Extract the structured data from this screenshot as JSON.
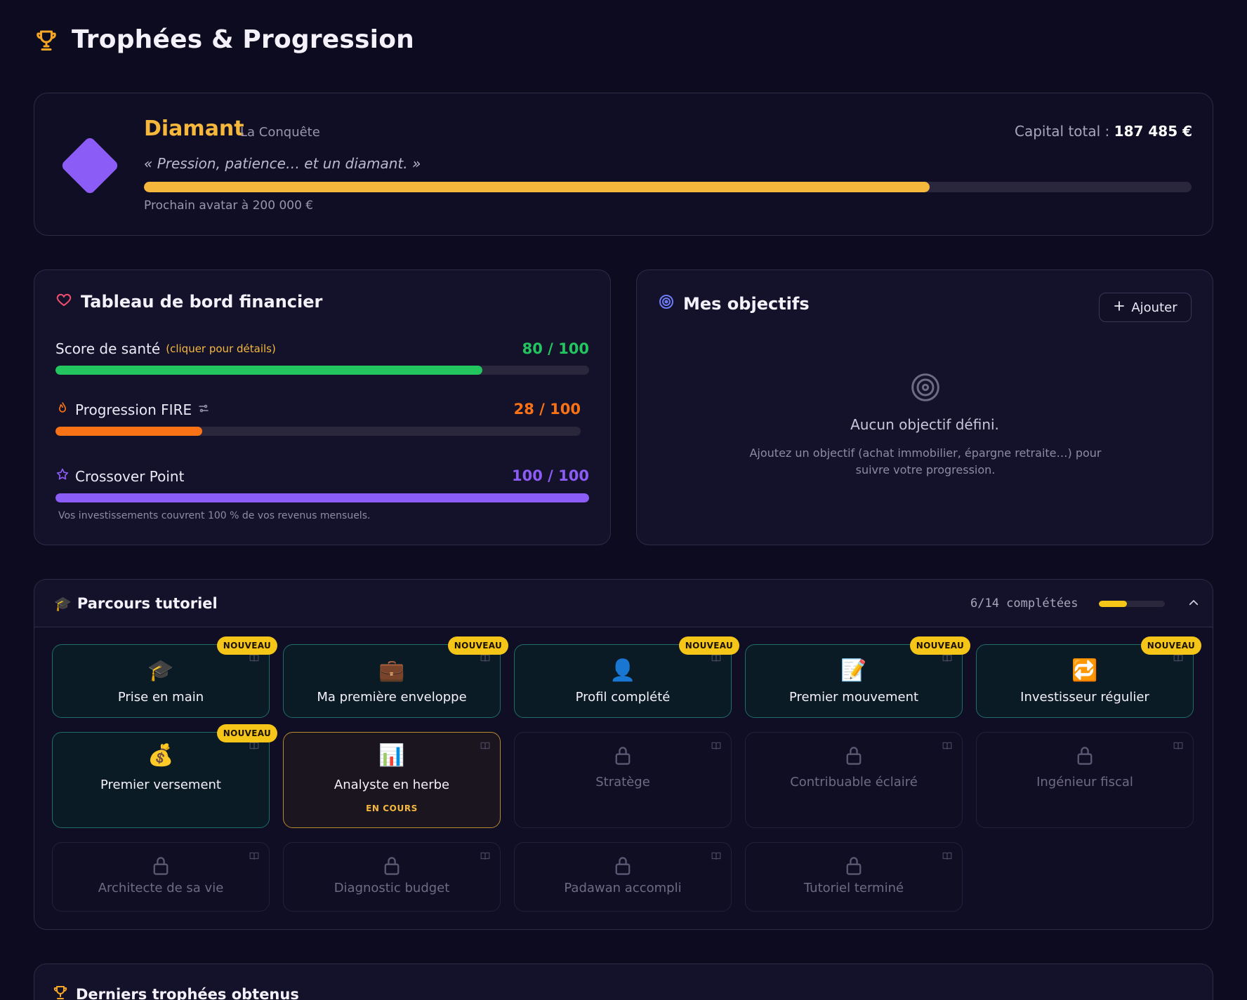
{
  "page": {
    "title": "Trophées & Progression"
  },
  "rank": {
    "name": "Diamant",
    "subtitle": "La Conquête",
    "quote": "« Pression, patience… et un diamant. »",
    "capital_label": "Capital total :",
    "capital_value": "187 485 €",
    "progress": 0.75,
    "next": "Prochain avatar à 200 000 €"
  },
  "dashboard": {
    "title": "Tableau de bord financier",
    "health": {
      "label": "Score de santé",
      "hint": "(cliquer pour détails)",
      "value": "80 / 100",
      "progress": 0.8,
      "color": "#22c55e"
    },
    "fire": {
      "label": "Progression FIRE",
      "value": "28 / 100",
      "progress": 0.28,
      "color": "#f97316"
    },
    "crossover": {
      "label": "Crossover Point",
      "value": "100 / 100",
      "progress": 1.0,
      "color": "#8b5cf6",
      "note": "Vos investissements couvrent 100 % de vos revenus mensuels."
    }
  },
  "goals": {
    "title": "Mes objectifs",
    "add_label": "Ajouter",
    "empty_title": "Aucun objectif défini.",
    "empty_desc": "Ajoutez un objectif (achat immobilier, épargne retraite…) pour suivre votre progression."
  },
  "tutorial": {
    "title": "Parcours tutoriel",
    "count": "6/14 complétées",
    "progress": 0.43,
    "badge_label": "NOUVEAU",
    "active_status": "EN COURS",
    "cards": [
      {
        "label": "Prise en main",
        "icon": "🎓",
        "state": "done",
        "badge": true
      },
      {
        "label": "Ma première enveloppe",
        "icon": "💼",
        "state": "done",
        "badge": true
      },
      {
        "label": "Profil complété",
        "icon": "👤",
        "state": "done",
        "badge": true
      },
      {
        "label": "Premier mouvement",
        "icon": "📝",
        "state": "done",
        "badge": true
      },
      {
        "label": "Investisseur régulier",
        "icon": "🔁",
        "state": "done",
        "badge": true
      },
      {
        "label": "Premier versement",
        "icon": "💰",
        "state": "done",
        "badge": true
      },
      {
        "label": "Analyste en herbe",
        "icon": "📊",
        "state": "active",
        "badge": false
      },
      {
        "label": "Stratège",
        "icon": "lock",
        "state": "locked",
        "badge": false
      },
      {
        "label": "Contribuable éclairé",
        "icon": "lock",
        "state": "locked",
        "badge": false
      },
      {
        "label": "Ingénieur fiscal",
        "icon": "lock",
        "state": "locked",
        "badge": false
      },
      {
        "label": "Architecte de sa vie",
        "icon": "lock",
        "state": "locked",
        "badge": false
      },
      {
        "label": "Diagnostic budget",
        "icon": "lock",
        "state": "locked",
        "badge": false
      },
      {
        "label": "Padawan accompli",
        "icon": "lock",
        "state": "locked",
        "badge": false
      },
      {
        "label": "Tutoriel terminé",
        "icon": "lock",
        "state": "locked",
        "badge": false
      }
    ]
  },
  "last_trophies": {
    "title": "Derniers trophées obtenus"
  }
}
